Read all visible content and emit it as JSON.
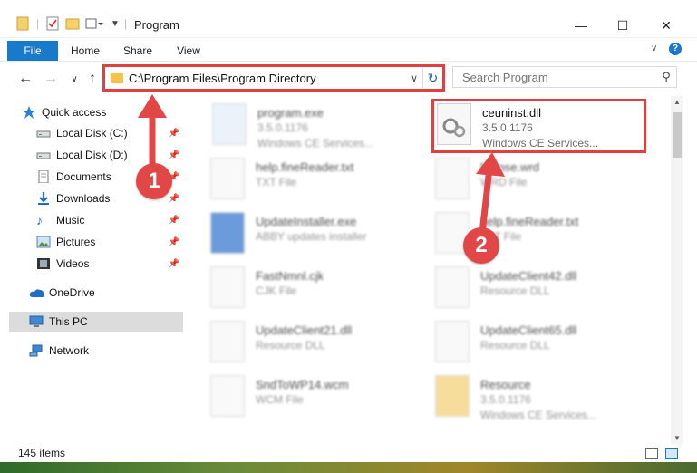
{
  "window": {
    "title": "Program",
    "minimize": "—",
    "maximize": "☐",
    "close": "✕"
  },
  "ribbon": {
    "tabs": [
      "File",
      "Home",
      "Share",
      "View"
    ]
  },
  "nav": {
    "path": "C:\\Program Files\\Program Directory",
    "search_placeholder": "Search Program"
  },
  "sidebar": {
    "items": [
      {
        "label": "Quick access",
        "icon": "star-icon"
      },
      {
        "label": "Local Disk (C:)",
        "icon": "drive-icon"
      },
      {
        "label": "Local Disk (D:)",
        "icon": "drive-icon"
      },
      {
        "label": "Documents",
        "icon": "documents-icon"
      },
      {
        "label": "Downloads",
        "icon": "download-icon"
      },
      {
        "label": "Music",
        "icon": "music-icon"
      },
      {
        "label": "Pictures",
        "icon": "pictures-icon"
      },
      {
        "label": "Videos",
        "icon": "videos-icon"
      },
      {
        "label": "OneDrive",
        "icon": "cloud-icon"
      },
      {
        "label": "This PC",
        "icon": "computer-icon"
      },
      {
        "label": "Network",
        "icon": "network-icon"
      }
    ]
  },
  "files": [
    {
      "name": "program.exe",
      "line1": "3.5.0.1176",
      "line2": "Windows CE Services..."
    },
    {
      "name": "ceuninst.dll",
      "line1": "3.5.0.1176",
      "line2": "Windows CE Services..."
    },
    {
      "name": "help.fineReader.txt",
      "line1": "TXT File",
      "line2": ""
    },
    {
      "name": "license.wrd",
      "line1": "WRD File",
      "line2": ""
    },
    {
      "name": "UpdateInstaller.exe",
      "line1": "ABBY updates installer",
      "line2": ""
    },
    {
      "name": "help.fineReader.txt",
      "line1": "TXT File",
      "line2": ""
    },
    {
      "name": "FastNmnl.cjk",
      "line1": "CJK File",
      "line2": ""
    },
    {
      "name": "UpdateClient42.dll",
      "line1": "Resource DLL",
      "line2": ""
    },
    {
      "name": "UpdateClient21.dll",
      "line1": "Resource DLL",
      "line2": ""
    },
    {
      "name": "UpdateClient65.dll",
      "line1": "Resource DLL",
      "line2": ""
    },
    {
      "name": "SndToWP14.wcm",
      "line1": "WCM File",
      "line2": ""
    },
    {
      "name": "Resource",
      "line1": "3.5.0.1176",
      "line2": "Windows CE Services..."
    }
  ],
  "status": {
    "item_count": "145 items"
  },
  "markers": [
    "1",
    "2"
  ],
  "colors": {
    "accent": "#1979ca",
    "highlight": "#e04040",
    "marker": "#e24747"
  }
}
